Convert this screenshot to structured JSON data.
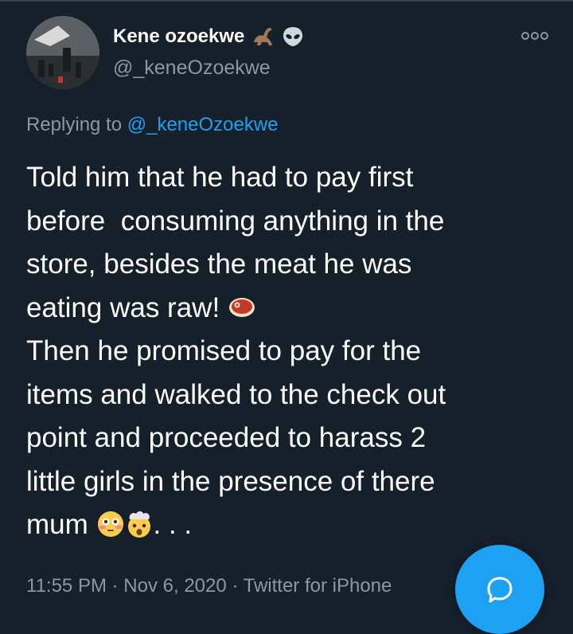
{
  "author": {
    "display_name": "Kene ozoekwe",
    "handle": "@_keneOzoekwe",
    "name_emojis": [
      "sauropod-emoji",
      "alien-emoji"
    ]
  },
  "reply": {
    "prefix": "Replying to ",
    "mention": "@_keneOzoekwe"
  },
  "tweet": {
    "line1": "Told him that he had to pay first",
    "line2": "before  consuming anything in the",
    "line3": "store, besides the meat he was",
    "line4": "eating was raw! ",
    "line5": "Then he promised to pay for the",
    "line6": "items and walked to the check out",
    "line7": "point and proceeded to harass 2",
    "line8": "little girls in the presence of there",
    "line9": "mum ",
    "line9_suffix": ". . .",
    "emojis": [
      "meat-emoji",
      "flushed-face-emoji",
      "exploding-head-emoji"
    ]
  },
  "meta": {
    "time": "11:55 PM",
    "date": "Nov 6, 2020",
    "source": "Twitter for iPhone",
    "separator": " · "
  },
  "actions": {
    "more_icon": "more-icon",
    "compose_icon": "reply-bubble-icon"
  },
  "colors": {
    "background": "#15202b",
    "text": "#ffffff",
    "secondary": "#8899a6",
    "accent": "#1da1f2"
  }
}
